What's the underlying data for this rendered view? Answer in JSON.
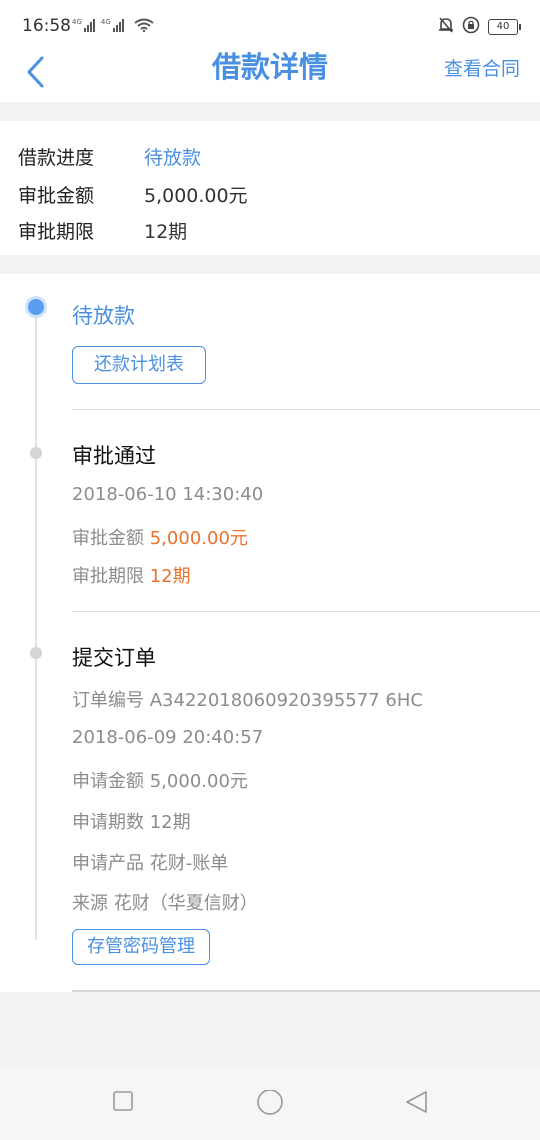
{
  "status_bar": {
    "time": "16:58",
    "sig1": "4G",
    "sig2": "4G",
    "battery": "40"
  },
  "nav": {
    "title": "借款详情",
    "action": "查看合同"
  },
  "summary": {
    "progress_label": "借款进度",
    "progress_value": "待放款",
    "amount_label": "审批金额",
    "amount_value": "5,000.00元",
    "term_label": "审批期限",
    "term_value": "12期"
  },
  "timeline": {
    "current": {
      "status": "待放款",
      "button": "还款计划表"
    },
    "approved": {
      "title": "审批通过",
      "time": "2018-06-10 14:30:40",
      "amount_label": "审批金额",
      "amount_value": "5,000.00元",
      "term_label": "审批期限",
      "term_value": "12期"
    },
    "submitted": {
      "title": "提交订单",
      "order_label": "订单编号",
      "order_value": "A3422018060920395577 6HC",
      "time": "2018-06-09 20:40:57",
      "amount_label": "申请金额",
      "amount_value": "5,000.00元",
      "periods_label": "申请期数",
      "periods_value": "12期",
      "product_label": "申请产品",
      "product_value": "花财-账单",
      "source_label": "来源",
      "source_value": "花财（华夏信财）",
      "button": "存管密码管理"
    }
  },
  "colors": {
    "accent": "#4a90e2",
    "highlight": "#e8742e"
  }
}
